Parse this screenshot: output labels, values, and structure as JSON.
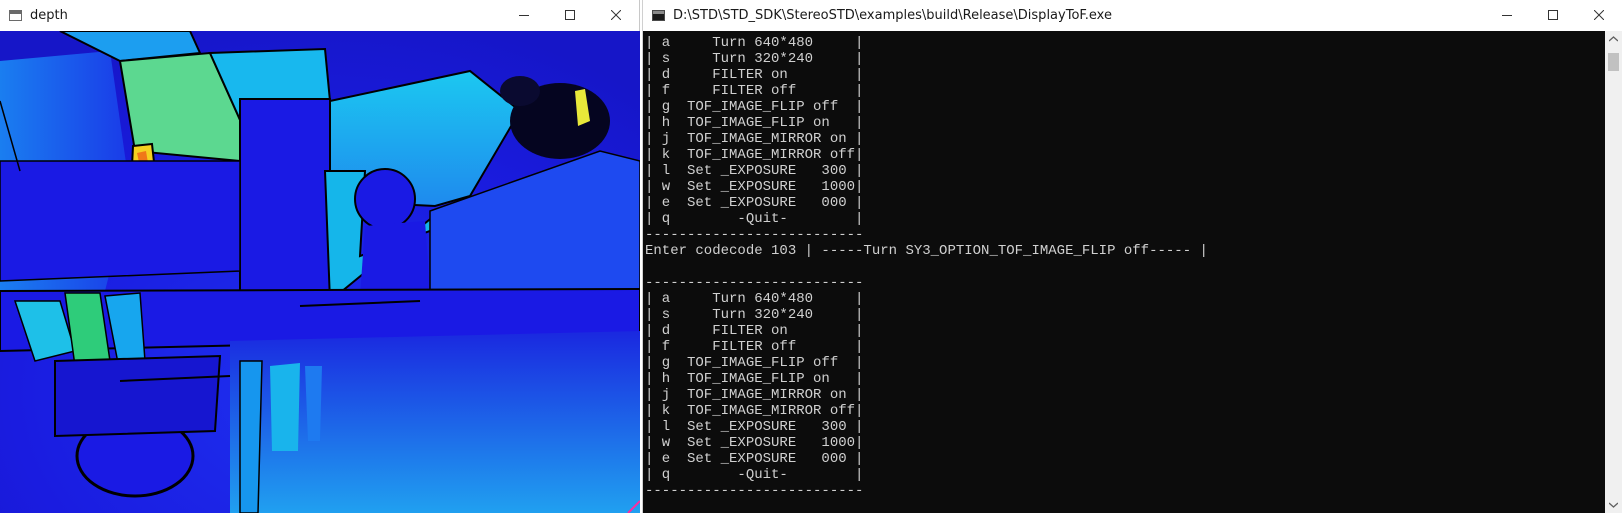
{
  "depth_window": {
    "title": "depth",
    "icon": "window-app-icon",
    "controls": [
      "minimize-icon",
      "maximize-icon",
      "close-icon"
    ]
  },
  "console_window": {
    "title": "D:\\STD\\STD_SDK\\StereoSTD\\examples\\build\\Release\\DisplayToF.exe",
    "icon": "console-app-icon",
    "controls": [
      "minimize-icon",
      "maximize-icon",
      "close-icon"
    ],
    "lines": [
      "| a     Turn 640*480     |",
      "| s     Turn 320*240     |",
      "| d     FILTER on        |",
      "| f     FILTER off       |",
      "| g  TOF_IMAGE_FLIP off  |",
      "| h  TOF_IMAGE_FLIP on   |",
      "| j  TOF_IMAGE_MIRROR on |",
      "| k  TOF_IMAGE_MIRROR off|",
      "| l  Set _EXPOSURE   300 |",
      "| w  Set _EXPOSURE   1000|",
      "| e  Set _EXPOSURE   000 |",
      "| q        -Quit-        |",
      "--------------------------",
      "Enter codecode 103 | -----Turn SY3_OPTION_TOF_IMAGE_FLIP off----- |",
      "",
      "--------------------------",
      "| a     Turn 640*480     |",
      "| s     Turn 320*240     |",
      "| d     FILTER on        |",
      "| f     FILTER off       |",
      "| g  TOF_IMAGE_FLIP off  |",
      "| h  TOF_IMAGE_FLIP on   |",
      "| j  TOF_IMAGE_MIRROR on |",
      "| k  TOF_IMAGE_MIRROR off|",
      "| l  Set _EXPOSURE   300 |",
      "| w  Set _EXPOSURE   1000|",
      "| e  Set _EXPOSURE   000 |",
      "| q        -Quit-        |",
      "--------------------------"
    ]
  },
  "colors": {
    "console_bg": "#0c0c0c",
    "console_text": "#d0d0d0",
    "depth_far": "#1a1ae0",
    "depth_mid": "#00b4e6",
    "depth_near": "#7cf07c"
  }
}
